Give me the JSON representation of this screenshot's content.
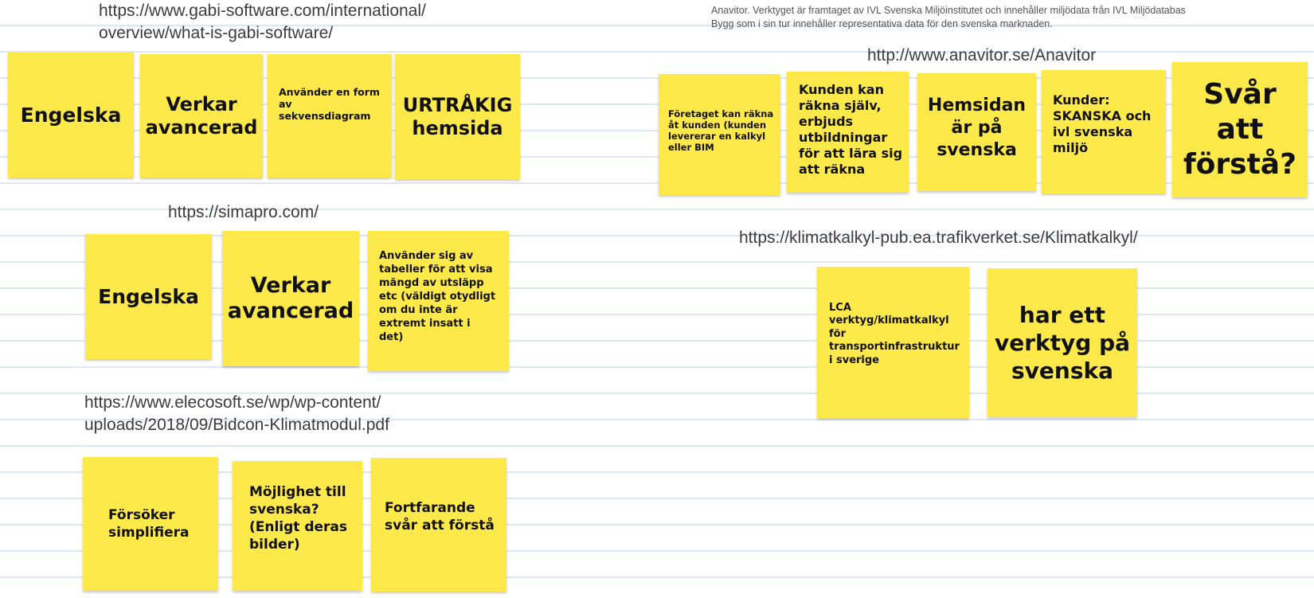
{
  "colors": {
    "sticky_note": "#fde94a",
    "board_line": "#dfe7f4",
    "board_background": "#ffffff",
    "link_text": "#3c3c3c"
  },
  "gabi": {
    "url_line1": "https://www.gabi-software.com/international/",
    "url_line2": "overview/what-is-gabi-software/",
    "notes": [
      "Engelska",
      "Verkar avancerad",
      "Använder en form av sekvensdiagram",
      "URTRÅKIG hemsida"
    ]
  },
  "simapro": {
    "url": "https://simapro.com/",
    "notes": [
      "Engelska",
      "Verkar avancerad",
      "Använder sig av tabeller för att visa mängd av utsläpp etc (väldigt otydligt om du inte är extremt insatt i det)"
    ]
  },
  "bidcon": {
    "url_line1": "https://www.elecosoft.se/wp/wp-content/",
    "url_line2": "uploads/2018/09/Bidcon-Klimatmodul.pdf",
    "notes": [
      "Försöker simplifiera",
      "Möjlighet till svenska? (Enligt deras bilder)",
      "Fortfarande svår att förstå"
    ]
  },
  "anavitor": {
    "description_line1": "Anavitor. Verktyget är framtaget av IVL Svenska Miljöinstitutet och innehåller miljödata från IVL Miljödatabas",
    "description_line2": "Bygg som i sin tur innehåller representativa data för den svenska marknaden.",
    "url": "http://www.anavitor.se/Anavitor",
    "notes": [
      "Företaget kan räkna åt kunden (kunden levererar en kalkyl eller BIM",
      "Kunden kan räkna själv, erbjuds utbildningar för att lära sig att räkna",
      "Hemsidan är på svenska",
      "Kunder: SKANSKA och ivl svenska miljö",
      "Svår att förstå?"
    ]
  },
  "klimatkalkyl": {
    "url": "https://klimatkalkyl-pub.ea.trafikverket.se/Klimatkalkyl/",
    "notes": [
      "LCA verktyg/klimatkalkyl för transportinfrastruktur i sverige",
      "har ett verktyg på svenska"
    ]
  }
}
